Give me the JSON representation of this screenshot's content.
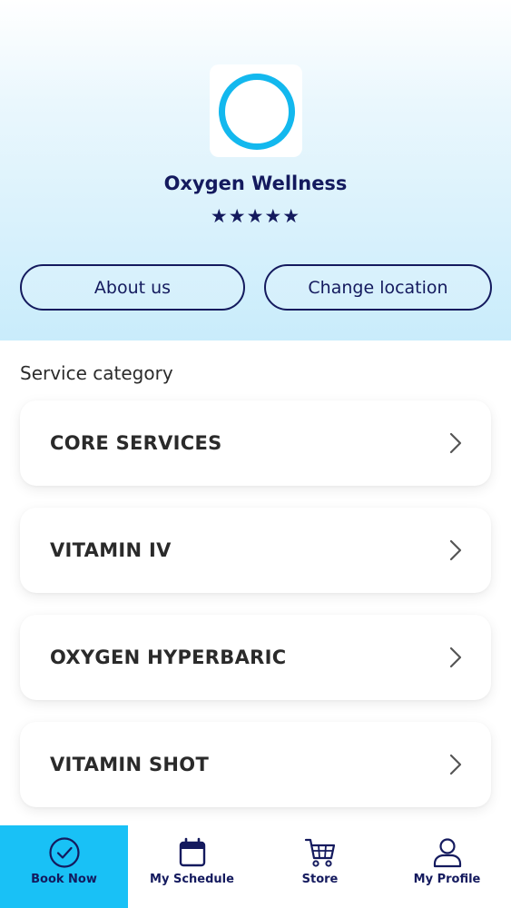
{
  "app": {
    "brand_name": "Oxygen Wellness",
    "stars": "★★★★★",
    "rating": 5,
    "accent_color": "#19c1f6",
    "navy_color": "#141a5e"
  },
  "header": {
    "about_label": "About us",
    "change_location_label": "Change location"
  },
  "services": {
    "section_title": "Service category",
    "items": [
      {
        "label": "CORE SERVICES"
      },
      {
        "label": "VITAMIN IV"
      },
      {
        "label": "OXYGEN HYPERBARIC"
      },
      {
        "label": "VITAMIN SHOT"
      }
    ]
  },
  "tabbar": {
    "items": [
      {
        "label": "Book Now",
        "icon": "check-circle-icon",
        "active": true
      },
      {
        "label": "My Schedule",
        "icon": "calendar-icon",
        "active": false
      },
      {
        "label": "Store",
        "icon": "cart-icon",
        "active": false
      },
      {
        "label": "My Profile",
        "icon": "user-icon",
        "active": false
      }
    ]
  }
}
